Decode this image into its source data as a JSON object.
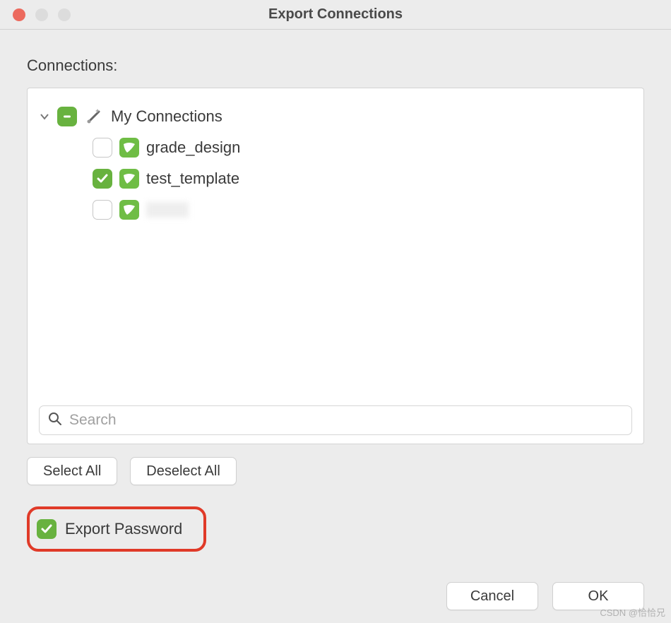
{
  "window": {
    "title": "Export Connections"
  },
  "section": {
    "label": "Connections:"
  },
  "tree": {
    "root": {
      "label": "My Connections",
      "expanded": true,
      "state": "indeterminate"
    },
    "items": [
      {
        "label": "grade_design",
        "checked": false
      },
      {
        "label": "test_template",
        "checked": true
      },
      {
        "label": "",
        "checked": false,
        "obscured": true
      }
    ]
  },
  "search": {
    "placeholder": "Search"
  },
  "buttons": {
    "select_all": "Select All",
    "deselect_all": "Deselect All",
    "cancel": "Cancel",
    "ok": "OK"
  },
  "export_password": {
    "label": "Export Password",
    "checked": true
  },
  "watermark": "CSDN @恰恰兄"
}
